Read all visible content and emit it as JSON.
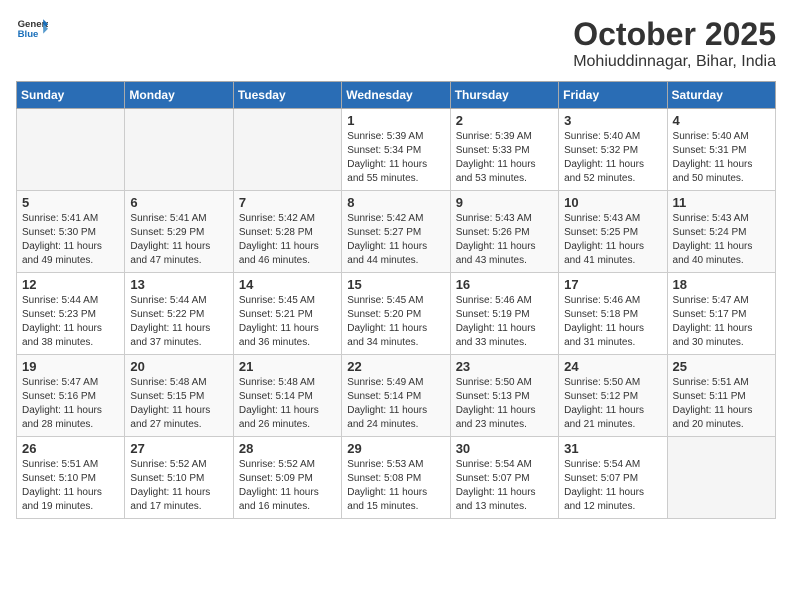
{
  "header": {
    "logo_general": "General",
    "logo_blue": "Blue",
    "month": "October 2025",
    "location": "Mohiuddinnagar, Bihar, India"
  },
  "weekdays": [
    "Sunday",
    "Monday",
    "Tuesday",
    "Wednesday",
    "Thursday",
    "Friday",
    "Saturday"
  ],
  "weeks": [
    [
      {
        "day": "",
        "empty": true
      },
      {
        "day": "",
        "empty": true
      },
      {
        "day": "",
        "empty": true
      },
      {
        "day": "1",
        "sunrise": "Sunrise: 5:39 AM",
        "sunset": "Sunset: 5:34 PM",
        "daylight": "Daylight: 11 hours and 55 minutes."
      },
      {
        "day": "2",
        "sunrise": "Sunrise: 5:39 AM",
        "sunset": "Sunset: 5:33 PM",
        "daylight": "Daylight: 11 hours and 53 minutes."
      },
      {
        "day": "3",
        "sunrise": "Sunrise: 5:40 AM",
        "sunset": "Sunset: 5:32 PM",
        "daylight": "Daylight: 11 hours and 52 minutes."
      },
      {
        "day": "4",
        "sunrise": "Sunrise: 5:40 AM",
        "sunset": "Sunset: 5:31 PM",
        "daylight": "Daylight: 11 hours and 50 minutes."
      }
    ],
    [
      {
        "day": "5",
        "sunrise": "Sunrise: 5:41 AM",
        "sunset": "Sunset: 5:30 PM",
        "daylight": "Daylight: 11 hours and 49 minutes."
      },
      {
        "day": "6",
        "sunrise": "Sunrise: 5:41 AM",
        "sunset": "Sunset: 5:29 PM",
        "daylight": "Daylight: 11 hours and 47 minutes."
      },
      {
        "day": "7",
        "sunrise": "Sunrise: 5:42 AM",
        "sunset": "Sunset: 5:28 PM",
        "daylight": "Daylight: 11 hours and 46 minutes."
      },
      {
        "day": "8",
        "sunrise": "Sunrise: 5:42 AM",
        "sunset": "Sunset: 5:27 PM",
        "daylight": "Daylight: 11 hours and 44 minutes."
      },
      {
        "day": "9",
        "sunrise": "Sunrise: 5:43 AM",
        "sunset": "Sunset: 5:26 PM",
        "daylight": "Daylight: 11 hours and 43 minutes."
      },
      {
        "day": "10",
        "sunrise": "Sunrise: 5:43 AM",
        "sunset": "Sunset: 5:25 PM",
        "daylight": "Daylight: 11 hours and 41 minutes."
      },
      {
        "day": "11",
        "sunrise": "Sunrise: 5:43 AM",
        "sunset": "Sunset: 5:24 PM",
        "daylight": "Daylight: 11 hours and 40 minutes."
      }
    ],
    [
      {
        "day": "12",
        "sunrise": "Sunrise: 5:44 AM",
        "sunset": "Sunset: 5:23 PM",
        "daylight": "Daylight: 11 hours and 38 minutes."
      },
      {
        "day": "13",
        "sunrise": "Sunrise: 5:44 AM",
        "sunset": "Sunset: 5:22 PM",
        "daylight": "Daylight: 11 hours and 37 minutes."
      },
      {
        "day": "14",
        "sunrise": "Sunrise: 5:45 AM",
        "sunset": "Sunset: 5:21 PM",
        "daylight": "Daylight: 11 hours and 36 minutes."
      },
      {
        "day": "15",
        "sunrise": "Sunrise: 5:45 AM",
        "sunset": "Sunset: 5:20 PM",
        "daylight": "Daylight: 11 hours and 34 minutes."
      },
      {
        "day": "16",
        "sunrise": "Sunrise: 5:46 AM",
        "sunset": "Sunset: 5:19 PM",
        "daylight": "Daylight: 11 hours and 33 minutes."
      },
      {
        "day": "17",
        "sunrise": "Sunrise: 5:46 AM",
        "sunset": "Sunset: 5:18 PM",
        "daylight": "Daylight: 11 hours and 31 minutes."
      },
      {
        "day": "18",
        "sunrise": "Sunrise: 5:47 AM",
        "sunset": "Sunset: 5:17 PM",
        "daylight": "Daylight: 11 hours and 30 minutes."
      }
    ],
    [
      {
        "day": "19",
        "sunrise": "Sunrise: 5:47 AM",
        "sunset": "Sunset: 5:16 PM",
        "daylight": "Daylight: 11 hours and 28 minutes."
      },
      {
        "day": "20",
        "sunrise": "Sunrise: 5:48 AM",
        "sunset": "Sunset: 5:15 PM",
        "daylight": "Daylight: 11 hours and 27 minutes."
      },
      {
        "day": "21",
        "sunrise": "Sunrise: 5:48 AM",
        "sunset": "Sunset: 5:14 PM",
        "daylight": "Daylight: 11 hours and 26 minutes."
      },
      {
        "day": "22",
        "sunrise": "Sunrise: 5:49 AM",
        "sunset": "Sunset: 5:14 PM",
        "daylight": "Daylight: 11 hours and 24 minutes."
      },
      {
        "day": "23",
        "sunrise": "Sunrise: 5:50 AM",
        "sunset": "Sunset: 5:13 PM",
        "daylight": "Daylight: 11 hours and 23 minutes."
      },
      {
        "day": "24",
        "sunrise": "Sunrise: 5:50 AM",
        "sunset": "Sunset: 5:12 PM",
        "daylight": "Daylight: 11 hours and 21 minutes."
      },
      {
        "day": "25",
        "sunrise": "Sunrise: 5:51 AM",
        "sunset": "Sunset: 5:11 PM",
        "daylight": "Daylight: 11 hours and 20 minutes."
      }
    ],
    [
      {
        "day": "26",
        "sunrise": "Sunrise: 5:51 AM",
        "sunset": "Sunset: 5:10 PM",
        "daylight": "Daylight: 11 hours and 19 minutes."
      },
      {
        "day": "27",
        "sunrise": "Sunrise: 5:52 AM",
        "sunset": "Sunset: 5:10 PM",
        "daylight": "Daylight: 11 hours and 17 minutes."
      },
      {
        "day": "28",
        "sunrise": "Sunrise: 5:52 AM",
        "sunset": "Sunset: 5:09 PM",
        "daylight": "Daylight: 11 hours and 16 minutes."
      },
      {
        "day": "29",
        "sunrise": "Sunrise: 5:53 AM",
        "sunset": "Sunset: 5:08 PM",
        "daylight": "Daylight: 11 hours and 15 minutes."
      },
      {
        "day": "30",
        "sunrise": "Sunrise: 5:54 AM",
        "sunset": "Sunset: 5:07 PM",
        "daylight": "Daylight: 11 hours and 13 minutes."
      },
      {
        "day": "31",
        "sunrise": "Sunrise: 5:54 AM",
        "sunset": "Sunset: 5:07 PM",
        "daylight": "Daylight: 11 hours and 12 minutes."
      },
      {
        "day": "",
        "empty": true
      }
    ]
  ]
}
